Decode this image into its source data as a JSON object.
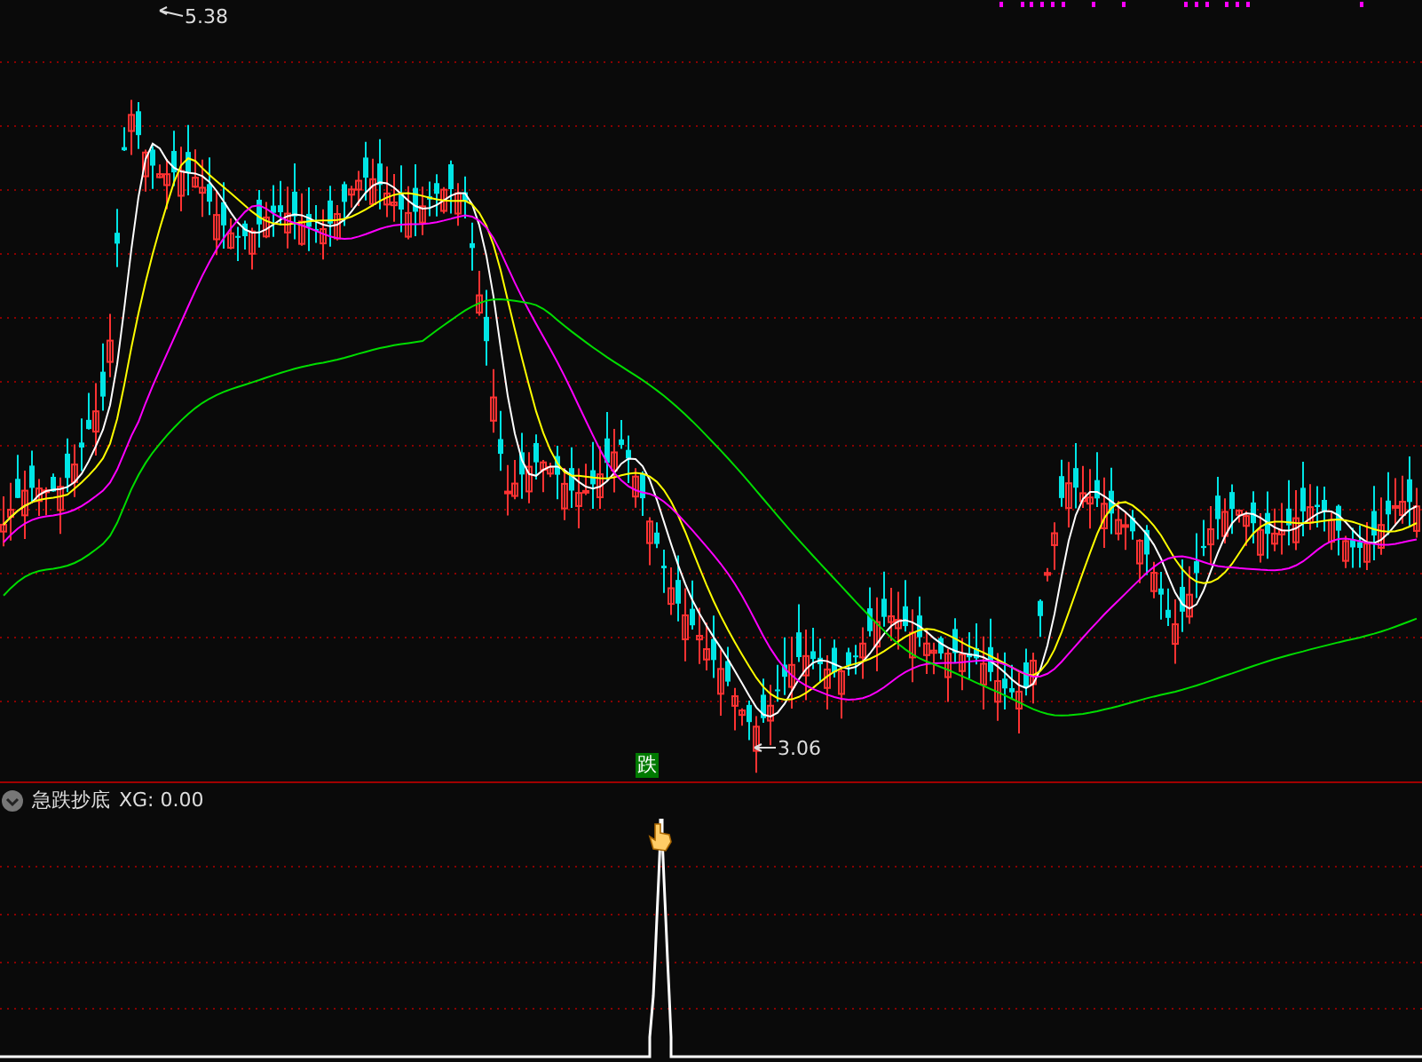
{
  "main_chart": {
    "high_label": "5.38",
    "low_label": "3.06",
    "signal_label": "跌"
  },
  "indicator": {
    "name": "急跌抄底",
    "reading": "XG: 0.00"
  }
}
